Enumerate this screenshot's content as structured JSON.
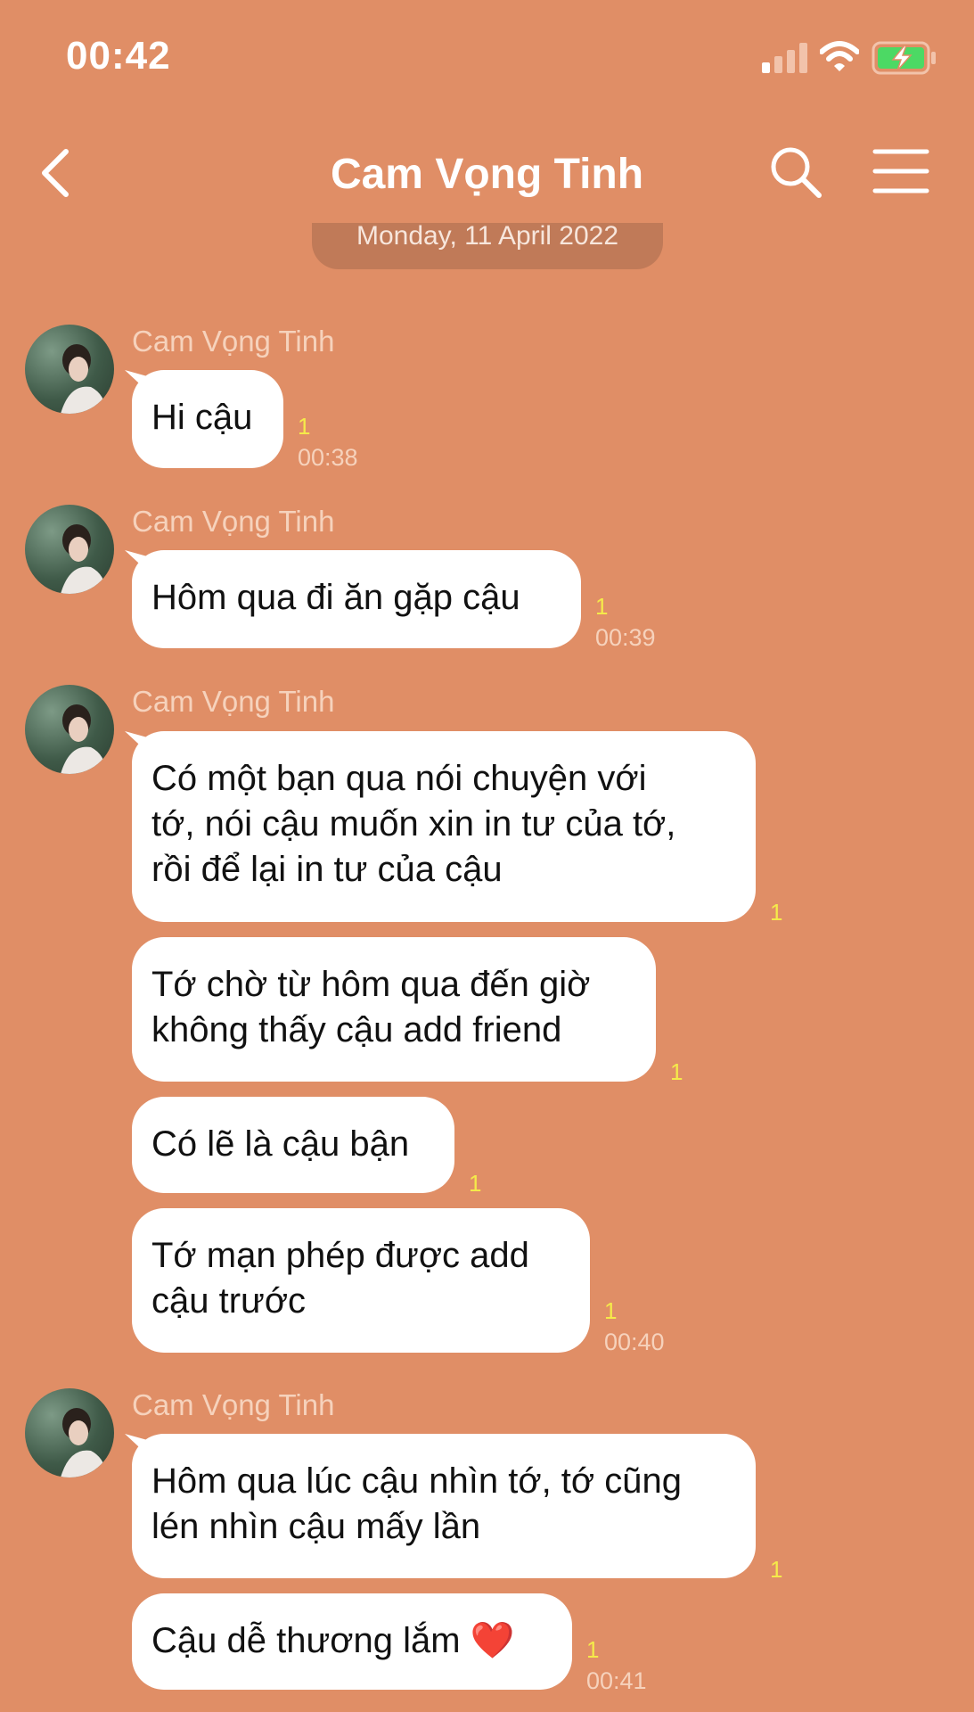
{
  "status_bar": {
    "time": "00:42",
    "icons": [
      "signal-icon",
      "wifi-icon",
      "battery-charging-icon"
    ]
  },
  "header": {
    "title": "Cam Vọng Tinh",
    "icons": [
      "back-chevron-icon",
      "search-icon",
      "menu-icon"
    ]
  },
  "date_separator": "Monday, 11 April 2022",
  "colors": {
    "background": "#e08e66",
    "bubble": "#ffffff",
    "read_count": "#f5ea4a",
    "meta_text": "#f6d2bc"
  },
  "messages": [
    {
      "sender": "Cam Vọng Tinh",
      "bubbles": [
        {
          "text": "Hi cậu",
          "read": "1",
          "time": "00:38"
        }
      ]
    },
    {
      "sender": "Cam Vọng Tinh",
      "bubbles": [
        {
          "text": "Hôm qua đi ăn gặp cậu",
          "read": "1",
          "time": "00:39"
        }
      ]
    },
    {
      "sender": "Cam Vọng Tinh",
      "bubbles": [
        {
          "text": "Có một bạn qua nói chuyện với\ntớ, nói cậu muốn xin in tư của tớ,\nrồi để lại in tư của cậu",
          "read": "1",
          "time": ""
        },
        {
          "text": "Tớ chờ từ hôm qua đến giờ\nkhông thấy cậu add friend",
          "read": "1",
          "time": ""
        },
        {
          "text": "Có lẽ là cậu bận",
          "read": "1",
          "time": ""
        },
        {
          "text": "Tớ mạn phép được add\ncậu trước",
          "read": "1",
          "time": "00:40"
        }
      ]
    },
    {
      "sender": "Cam Vọng Tinh",
      "bubbles": [
        {
          "text": "Hôm qua lúc cậu nhìn tớ, tớ cũng\nlén nhìn cậu mấy lần",
          "read": "1",
          "time": ""
        },
        {
          "text": "Cậu dễ thương lắm ❤️",
          "read": "1",
          "time": "00:41"
        }
      ]
    }
  ]
}
